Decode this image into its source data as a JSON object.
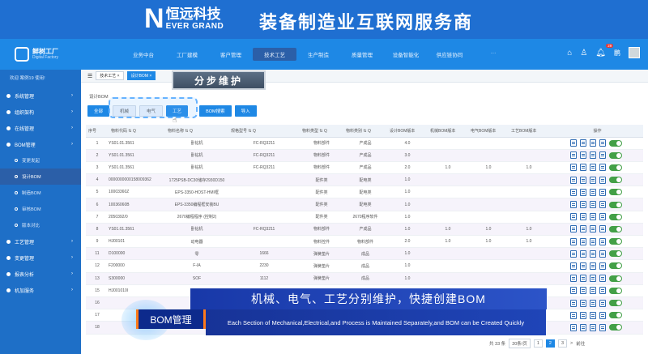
{
  "banner": {
    "logo_letter": "N",
    "company_cn": "恒远科技",
    "company_en": "EVER GRAND",
    "slogan": "装备制造业互联网服务商"
  },
  "app": {
    "name": "鲜树工厂",
    "sub": "Digital Factory"
  },
  "menu": [
    {
      "label": "业务中台",
      "active": false
    },
    {
      "label": "工厂建模",
      "active": false
    },
    {
      "label": "客户管理",
      "active": false
    },
    {
      "label": "技术工艺",
      "active": true
    },
    {
      "label": "生产制造",
      "active": false
    },
    {
      "label": "质量管理",
      "active": false
    },
    {
      "label": "设备智能化",
      "active": false
    },
    {
      "label": "供应链协同",
      "active": false
    },
    {
      "label": "···",
      "active": false
    }
  ],
  "header_icons": {
    "badge_count": "29",
    "user": "鹏"
  },
  "sidebar": {
    "welcome": "欢迎 案例19 使用!",
    "items": [
      {
        "label": "系统管理",
        "type": "item"
      },
      {
        "label": "组织架构",
        "type": "item"
      },
      {
        "label": "在线管理",
        "type": "item"
      },
      {
        "label": "BOM管理",
        "type": "item"
      },
      {
        "label": "变更发起",
        "type": "sub"
      },
      {
        "label": "设计BOM",
        "type": "sub",
        "active": true
      },
      {
        "label": "制造BOM",
        "type": "sub"
      },
      {
        "label": "审核BOM",
        "type": "sub"
      },
      {
        "label": "版本对比",
        "type": "sub"
      },
      {
        "label": "工艺管理",
        "type": "item"
      },
      {
        "label": "变更管理",
        "type": "item"
      },
      {
        "label": "报表分析",
        "type": "item"
      },
      {
        "label": "机加服务",
        "type": "item"
      }
    ]
  },
  "breadcrumb": {
    "tab1": "技术工艺 ×",
    "tab2": "设计BOM ×"
  },
  "page_title": "设计BOM",
  "tabs": [
    {
      "label": "全部",
      "style": "primary"
    },
    {
      "label": "机械",
      "style": "plain"
    },
    {
      "label": "电气",
      "style": "plain"
    },
    {
      "label": "工艺",
      "style": "highlight"
    },
    {
      "label": "BOM搜索",
      "style": "primary"
    },
    {
      "label": "导入",
      "style": "primary"
    }
  ],
  "callout": "分步维护",
  "table": {
    "headers": [
      "序号",
      "物料代码 ⇅ Q",
      "物料名称 ⇅ Q",
      "规格型号 ⇅ Q",
      "物料类型 ⇅ Q",
      "物料类别 ⇅ Q",
      "设计BOM版本",
      "机械BOM版本",
      "电气BOM版本",
      "工艺BOM版本",
      "操作"
    ],
    "rows": [
      [
        "1",
        "YS01.01.3561",
        "卧钻机",
        "FC-RQ3211",
        "物料部件",
        "产成品",
        "4.0",
        "",
        "",
        ""
      ],
      [
        "2",
        "YS01.01.3561",
        "卧钻机",
        "FC-RQ3211",
        "物料部件",
        "产成品",
        "3.0",
        "",
        "",
        ""
      ],
      [
        "3",
        "YS01.01.3561",
        "卧钻机",
        "FC-RQ3211",
        "物料部件",
        "产成品",
        "2.0",
        "1.0",
        "1.0",
        "1.0"
      ],
      [
        "4",
        "0000000000158009362",
        "1725PSB-DC30储存2930D150",
        "",
        "配件类",
        "配电类",
        "1.0",
        "",
        "",
        ""
      ],
      [
        "5",
        "10003360Z",
        "EPS-3350-HOST-HMI框",
        "",
        "配件类",
        "配电类",
        "1.0",
        "",
        "",
        ""
      ],
      [
        "6",
        "10036060B",
        "EPS-3350编程框安装BU",
        "",
        "配件类",
        "配电类",
        "1.0",
        "",
        "",
        ""
      ],
      [
        "7",
        "2050392/0",
        "2670编程程序 (控制2)",
        "",
        "配件类",
        "2670程序软件",
        "1.0",
        "",
        "",
        ""
      ],
      [
        "8",
        "YS01.01.3561",
        "卧钻机",
        "FC-RQ3211",
        "物料部件",
        "产成品",
        "1.0",
        "1.0",
        "1.0",
        "1.0"
      ],
      [
        "9",
        "HJ00101",
        "动电器",
        "",
        "物料控件",
        "物料部件",
        "2.0",
        "1.0",
        "1.0",
        "1.0"
      ],
      [
        "11",
        "D100000",
        "零",
        "1666",
        "弹簧垫片",
        "成品",
        "1.0",
        "",
        "",
        ""
      ],
      [
        "12",
        "F200000",
        "F-IA",
        "2230",
        "弹簧垫片",
        "成品",
        "1.0",
        "",
        "",
        ""
      ],
      [
        "13",
        "S300000",
        "SOF",
        "1112",
        "弹簧垫片",
        "成品",
        "1.0",
        "",
        "",
        ""
      ],
      [
        "15",
        "HJ001010I",
        "",
        "",
        "",
        "",
        "",
        "",
        "",
        ""
      ],
      [
        "16",
        "",
        "",
        "",
        "",
        "",
        "",
        "",
        "",
        ""
      ],
      [
        "17",
        "",
        "",
        "",
        "",
        "",
        "",
        "",
        "",
        ""
      ],
      [
        "18",
        "",
        "",
        "",
        "",
        "",
        "",
        "",
        "",
        ""
      ]
    ]
  },
  "overlay": {
    "headline": "机械、电气、工艺分别维护，快捷创建BOM",
    "tag": "BOM管理",
    "subtitle": "Each Section of Mechanical,Electrical,and Process is Maintained Separately,and BOM can be Created Quickly"
  },
  "pager": {
    "total": "共 33 条",
    "size": "20条/页",
    "pages": [
      "1",
      "2",
      "3"
    ],
    "next": ">",
    "goto": "前往"
  }
}
